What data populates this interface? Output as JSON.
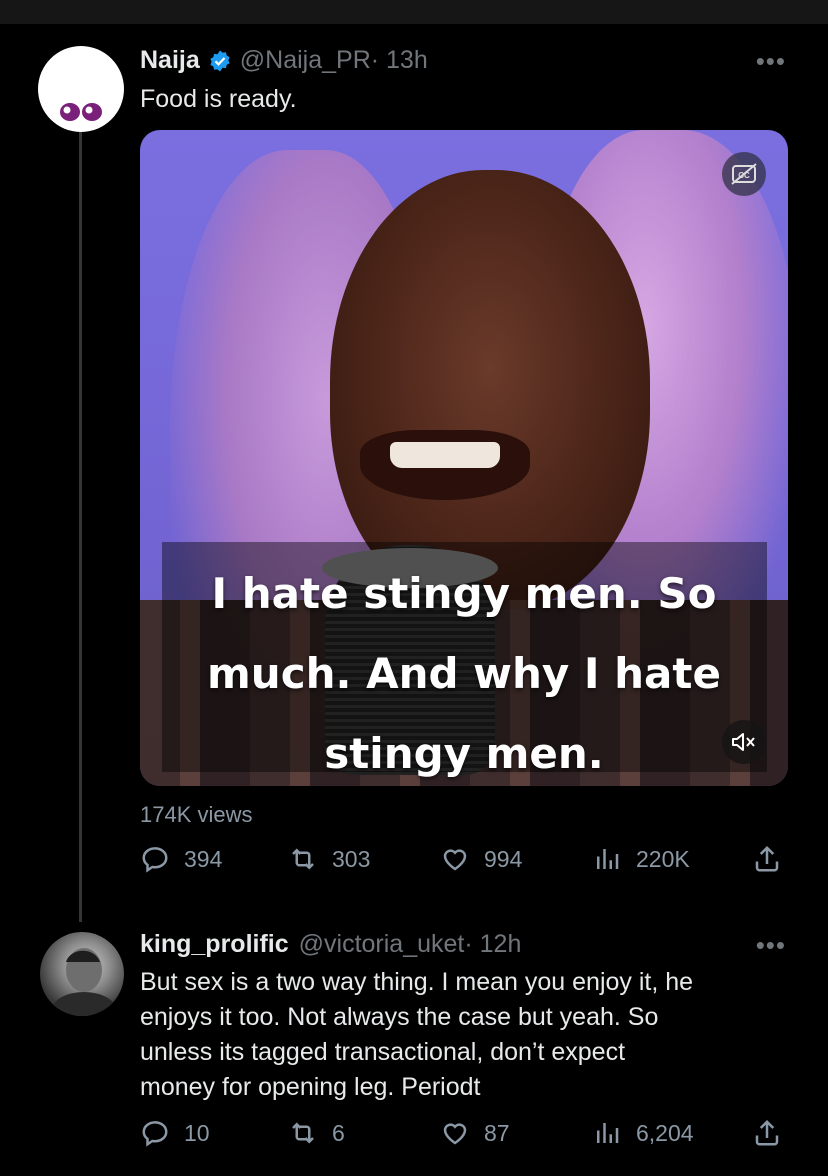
{
  "tweet": {
    "author_name": "Naija",
    "author_handle": "@Naija_PR",
    "time": "· 13h",
    "text": "Food is ready.",
    "video_caption": [
      "I hate stingy men. So",
      "much. And why I hate",
      "stingy men."
    ],
    "views": "174K views",
    "stats": {
      "replies": "394",
      "retweets": "303",
      "likes": "994",
      "views": "220K"
    },
    "icons": [
      "verified-badge-icon",
      "more-icon",
      "captions-icon",
      "mute-icon",
      "reply-icon",
      "retweet-icon",
      "like-icon",
      "views-icon",
      "share-icon"
    ]
  },
  "reply": {
    "author_name": "king_prolific",
    "author_handle": "@victoria_uket",
    "time": "· 12h",
    "text_lines": [
      "But sex is a two way thing. I mean you enjoy it, he",
      "enjoys it too. Not always the case but yeah. So",
      "unless its tagged transactional, don’t expect",
      "money for opening leg. Periodt"
    ],
    "stats": {
      "replies": "10",
      "retweets": "6",
      "likes": "87",
      "views": "6,204"
    }
  },
  "colors": {
    "background": "#000000",
    "text": "#e7e9ea",
    "muted": "#71767b",
    "verified": "#1d9bf0",
    "avatar_eyes": "#7a1f7a"
  }
}
